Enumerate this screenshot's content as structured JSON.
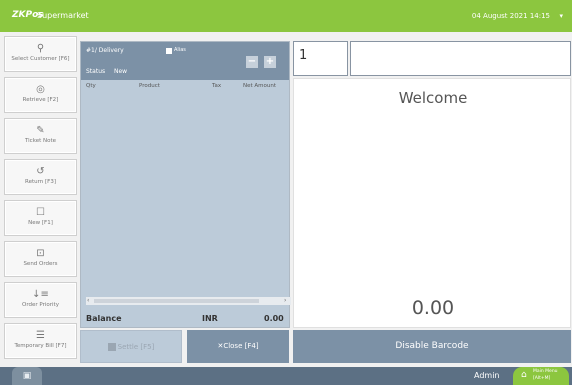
{
  "header": {
    "brand": "ZKPos",
    "app_name": "Supermarket",
    "datetime": "04 August 2021 14:15",
    "caret": "▾"
  },
  "sidebar": {
    "items": [
      {
        "label": "Select Customer [F6]",
        "icon": "user-icon"
      },
      {
        "label": "Retrieve [F2]",
        "icon": "retrieve-icon"
      },
      {
        "label": "Ticket Note",
        "icon": "note-icon"
      },
      {
        "label": "Return [F3]",
        "icon": "return-icon"
      },
      {
        "label": "New [F1]",
        "icon": "new-icon"
      },
      {
        "label": "Send Orders",
        "icon": "send-icon"
      },
      {
        "label": "Order Priority",
        "icon": "priority-icon"
      },
      {
        "label": "Temporary Bill [F7]",
        "icon": "temporary-bill-icon"
      }
    ]
  },
  "order": {
    "title": "#1/ Delivery",
    "alias_label": "Alias",
    "status_label": "Status",
    "status_value": "New",
    "minus_label": "−",
    "plus_label": "+",
    "columns": [
      "Qty",
      "Product",
      "Tax",
      "Net Amount"
    ],
    "scroll_left": "‹",
    "scroll_right": "›",
    "balance_label": "Balance",
    "currency": "INR",
    "balance_value": "0.00"
  },
  "actions": {
    "settle_label": "Settle [F5]",
    "close_label": "Close [F4]",
    "close_icon": "✕"
  },
  "right": {
    "quantity_value": "1",
    "barcode_value": "",
    "welcome": "Welcome",
    "total": "0.00",
    "disable_barcode_label": "Disable Barcode"
  },
  "footer": {
    "user": "Admin",
    "main_menu_line1": "Main Menu",
    "main_menu_line2": "[Alt+M]"
  },
  "colors": {
    "header_green": "#8cc63f",
    "slate": "#7c91a6",
    "order_bg": "#bccbd9",
    "footer": "#5c7084"
  }
}
